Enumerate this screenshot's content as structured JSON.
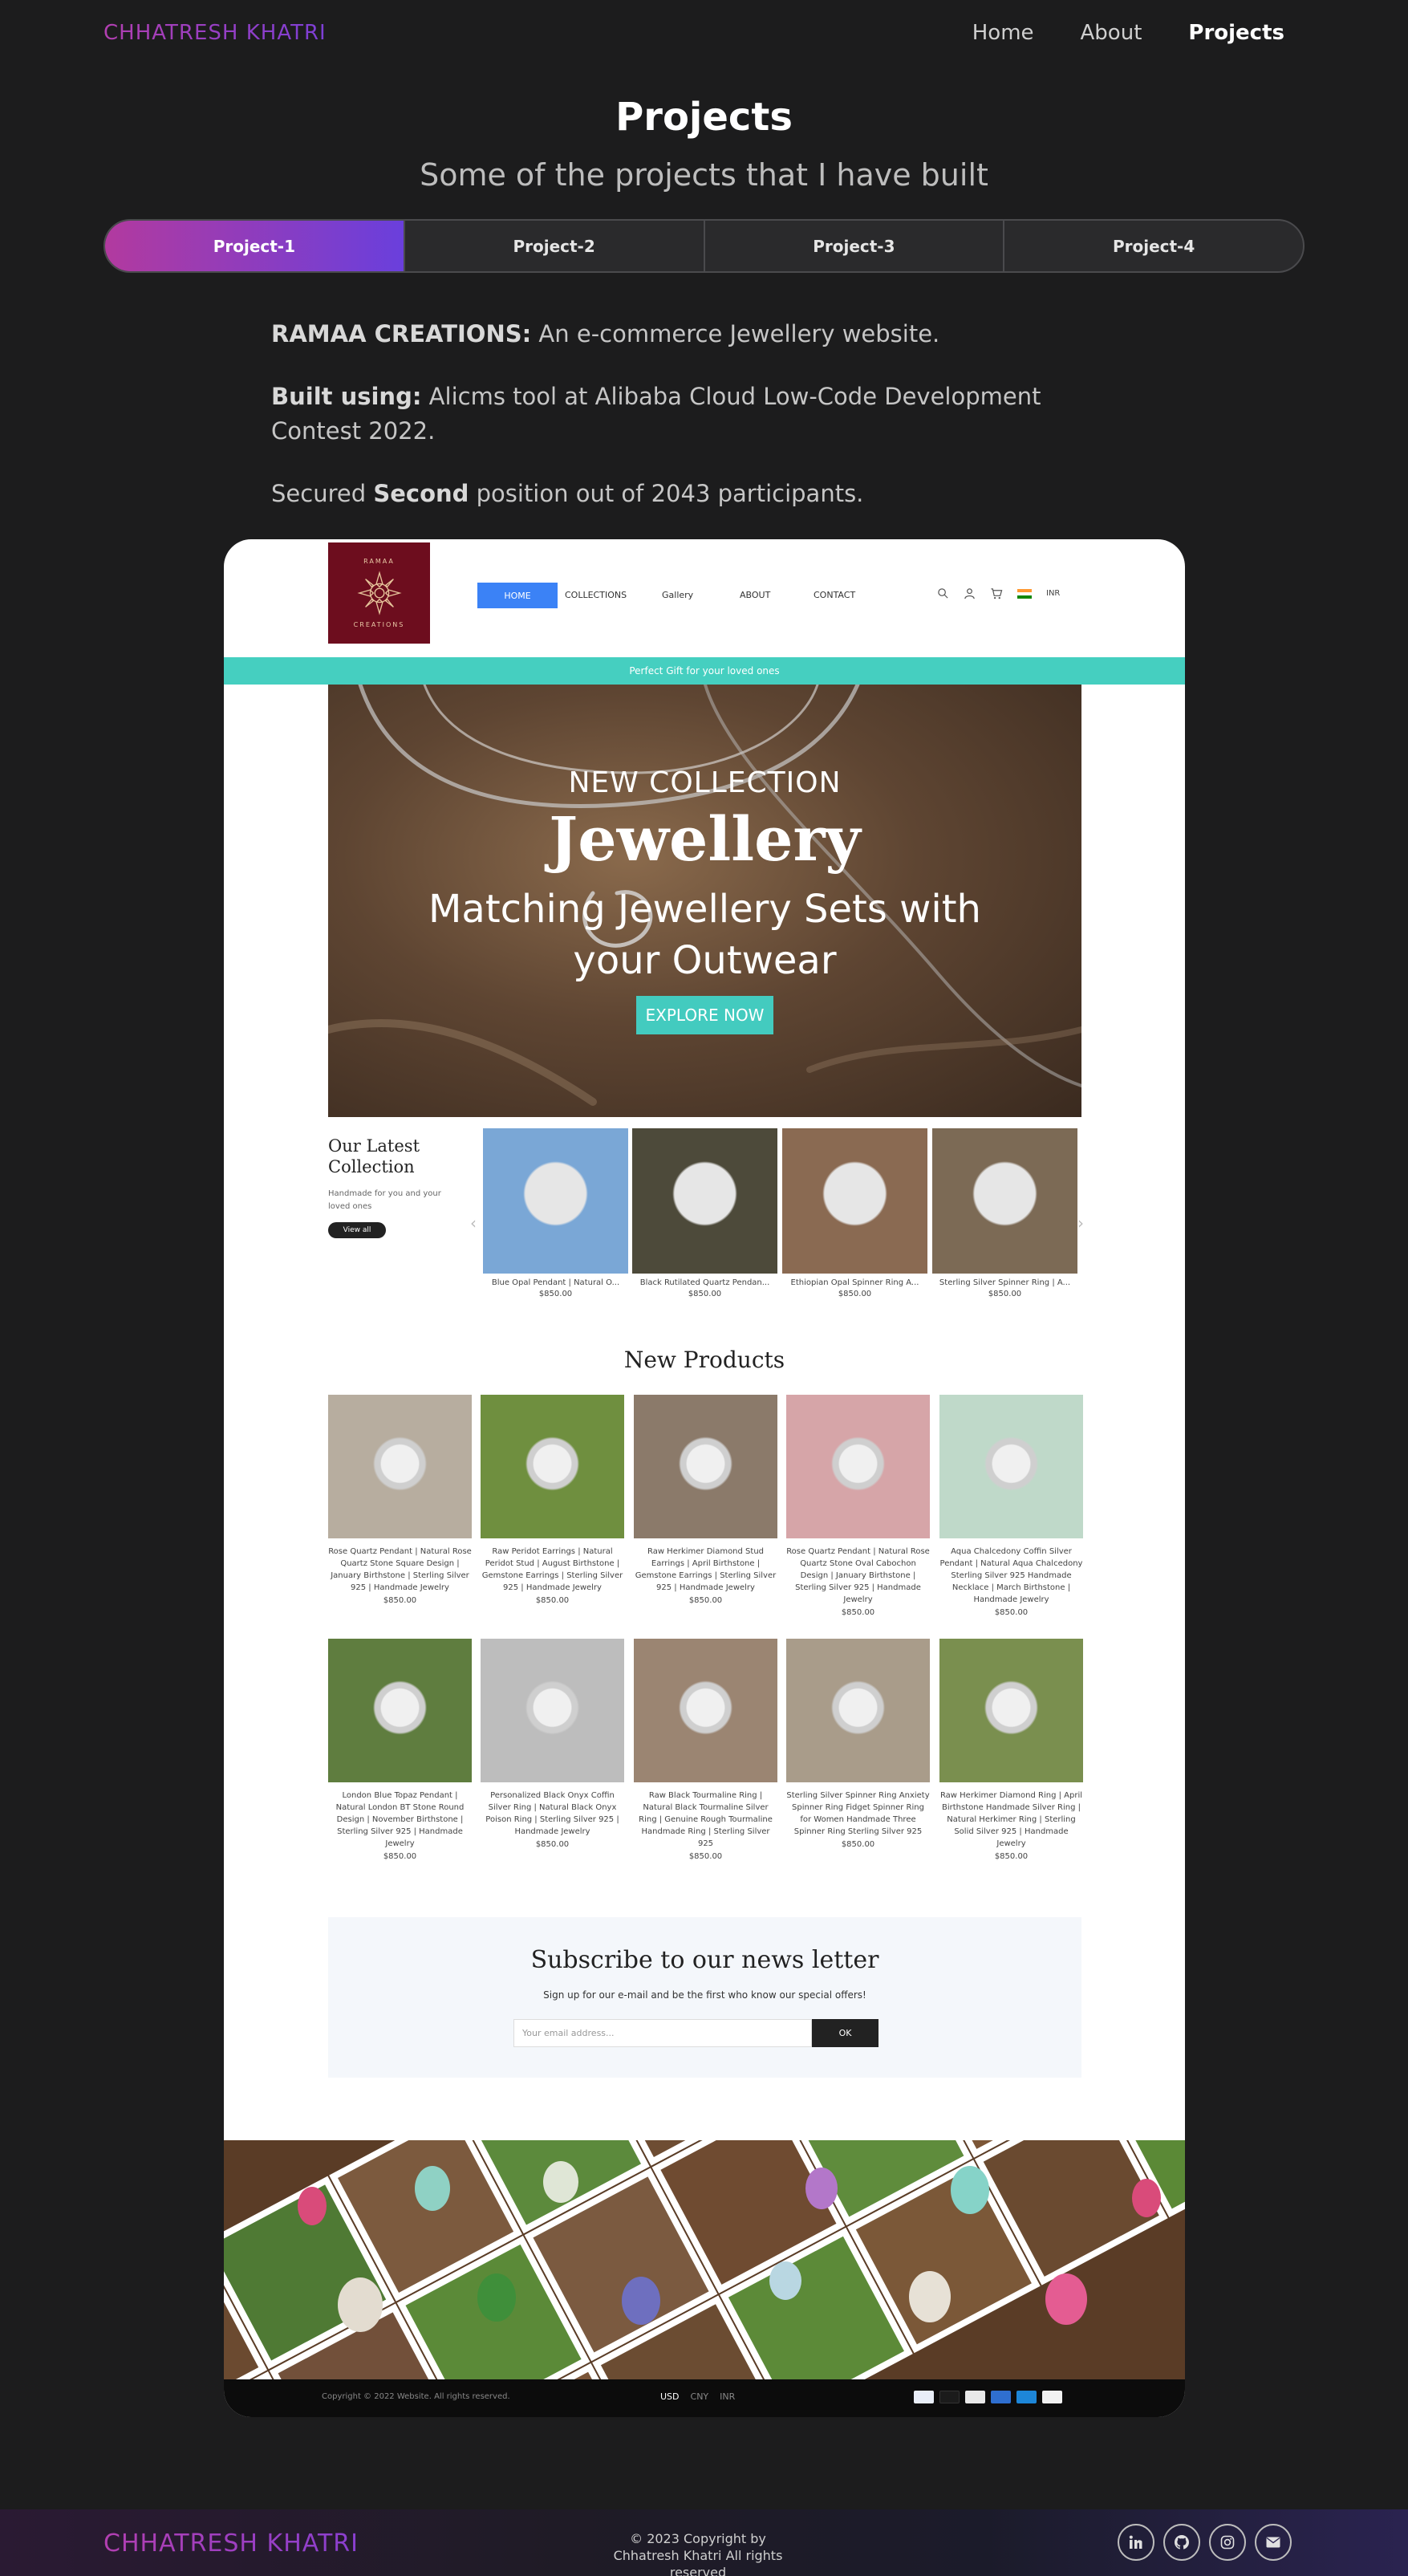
{
  "brand": "CHHATRESH KHATRI",
  "nav": {
    "items": [
      "Home",
      "About",
      "Projects"
    ],
    "active": "Projects"
  },
  "section": {
    "title": "Projects",
    "subtitle": "Some of the projects that I have built"
  },
  "tabs": [
    "Project-1",
    "Project-2",
    "Project-3",
    "Project-4"
  ],
  "description": {
    "name_label": "RAMAA CREATIONS:",
    "name_text": " An e-commerce Jewellery website.",
    "built_label": "Built using:",
    "built_text": " Alicms tool at Alibaba Cloud Low-Code Development Contest 2022.",
    "secured_pre": "Secured ",
    "secured_bold": "Second",
    "secured_post": " position out of 2043 participants."
  },
  "shop": {
    "logo_top": "RAMAA",
    "logo_bottom": "CREATIONS",
    "menu": [
      "HOME",
      "COLLECTIONS",
      "Gallery",
      "ABOUT",
      "CONTACT"
    ],
    "currency_short": "INR",
    "strip": "Perfect Gift for your loved ones",
    "hero": {
      "eyebrow": "NEW COLLECTION",
      "title": "Jewellery",
      "subtitle": "Matching Jewellery Sets with your Outwear",
      "cta": "EXPLORE NOW"
    },
    "latest": {
      "title": "Our Latest Collection",
      "desc": "Handmade for you and your loved ones",
      "button": "View all",
      "items": [
        {
          "name": "Blue Opal Pendant | Natural O...",
          "price": "$850.00",
          "color": "#7aa7d6"
        },
        {
          "name": "Black Rutilated Quartz Pendan...",
          "price": "$850.00",
          "color": "#4d4a3a"
        },
        {
          "name": "Ethiopian Opal Spinner Ring A...",
          "price": "$850.00",
          "color": "#8a6a52"
        },
        {
          "name": "Sterling Silver Spinner Ring | A...",
          "price": "$850.00",
          "color": "#7c6a55"
        }
      ]
    },
    "new_products": {
      "title": "New Products",
      "items": [
        {
          "name": "Rose Quartz Pendant | Natural Rose Quartz Stone Square Design | January Birthstone | Sterling Silver 925 | Handmade Jewelry",
          "price": "$850.00",
          "color": "#b7ad9f"
        },
        {
          "name": "Raw Peridot Earrings | Natural Peridot Stud | August Birthstone | Gemstone Earrings | Sterling Silver 925 | Handmade Jewelry",
          "price": "$850.00",
          "color": "#6f8f3f"
        },
        {
          "name": "Raw Herkimer Diamond Stud Earrings | April Birthstone | Gemstone Earrings | Sterling Silver 925 | Handmade Jewelry",
          "price": "$850.00",
          "color": "#8b7a6a"
        },
        {
          "name": "Rose Quartz Pendant | Natural Rose Quartz Stone Oval Cabochon Design | January Birthstone | Sterling Silver 925 | Handmade Jewelry",
          "price": "$850.00",
          "color": "#d6a5a8"
        },
        {
          "name": "Aqua Chalcedony Coffin Silver Pendant | Natural Aqua Chalcedony Sterling Silver 925 Handmade Necklace | March Birthstone | Handmade Jewelry",
          "price": "$850.00",
          "color": "#bfd9c9"
        },
        {
          "name": "London Blue Topaz Pendant | Natural London BT Stone Round Design | November Birthstone | Sterling Silver 925 | Handmade Jewelry",
          "price": "$850.00",
          "color": "#5f7d3f"
        },
        {
          "name": "Personalized Black Onyx Coffin Silver Ring | Natural Black Onyx Poison Ring | Sterling Silver 925 | Handmade Jewelry",
          "price": "$850.00",
          "color": "#bdbdbd"
        },
        {
          "name": "Raw Black Tourmaline Ring | Natural Black Tourmaline Silver Ring | Genuine Rough Tourmaline Handmade Ring | Sterling Silver 925",
          "price": "$850.00",
          "color": "#9b8572"
        },
        {
          "name": "Sterling Silver Spinner Ring Anxiety Spinner Ring Fidget Spinner Ring for Women Handmade Three Spinner Ring Sterling Silver 925",
          "price": "$850.00",
          "color": "#a99c8a"
        },
        {
          "name": "Raw Herkimer Diamond Ring | April Birthstone Handmade Silver Ring | Natural Herkimer Ring | Sterling Solid Silver 925 | Handmade Jewelry",
          "price": "$850.00",
          "color": "#7a8f4f"
        }
      ]
    },
    "newsletter": {
      "title": "Subscribe to our news letter",
      "subtitle": "Sign up for our e-mail and be the first who know our special offers!",
      "placeholder": "Your email address...",
      "button": "OK"
    },
    "footer": {
      "copyright": "Copyright © 2022 Website. All rights reserved.",
      "currencies": [
        "USD",
        "CNY",
        "INR"
      ],
      "selected_currency": "USD"
    }
  },
  "footer": {
    "brand": "CHHATRESH KHATRI",
    "copyright": "© 2023 Copyright by Chhatresh Khatri All rights reserved",
    "social": [
      "linkedin-icon",
      "github-icon",
      "instagram-icon",
      "mail-icon"
    ]
  },
  "colors": {
    "accent_start": "#b23fb1",
    "accent_end": "#6a3fdc",
    "shop_teal": "#45cfc0",
    "shop_blue": "#3b82f6"
  }
}
